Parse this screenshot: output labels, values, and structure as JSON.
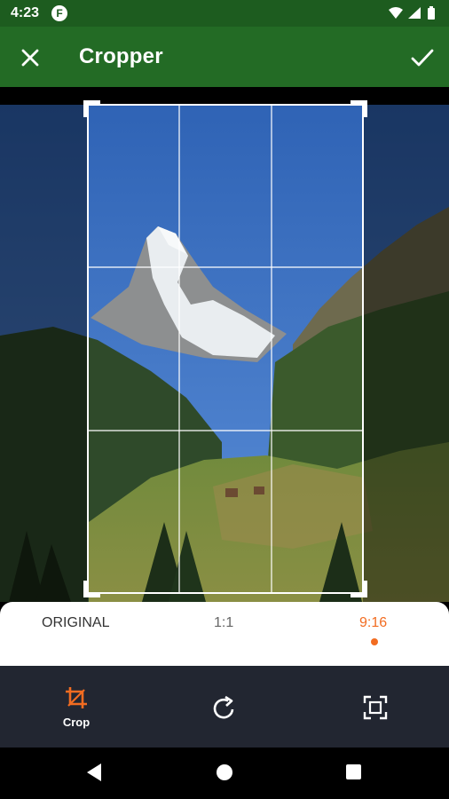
{
  "status": {
    "time": "4:23",
    "app_badge": "F"
  },
  "appbar": {
    "title": "Cropper"
  },
  "ratios": {
    "original": "ORIGINAL",
    "one_to_one": "1:1",
    "nine_sixteen": "9:16",
    "selected": "9:16"
  },
  "toolbar": {
    "crop_label": "Crop"
  },
  "colors": {
    "status_bar": "#1d5c1f",
    "app_bar": "#236b25",
    "accent": "#f26c21",
    "toolbar": "#222631"
  },
  "icons": {
    "close": "close-icon",
    "confirm": "check-icon",
    "crop": "crop-icon",
    "rotate": "rotate-icon",
    "fit": "fit-screen-icon",
    "wifi": "wifi-icon",
    "signal": "signal-icon",
    "battery": "battery-icon"
  }
}
